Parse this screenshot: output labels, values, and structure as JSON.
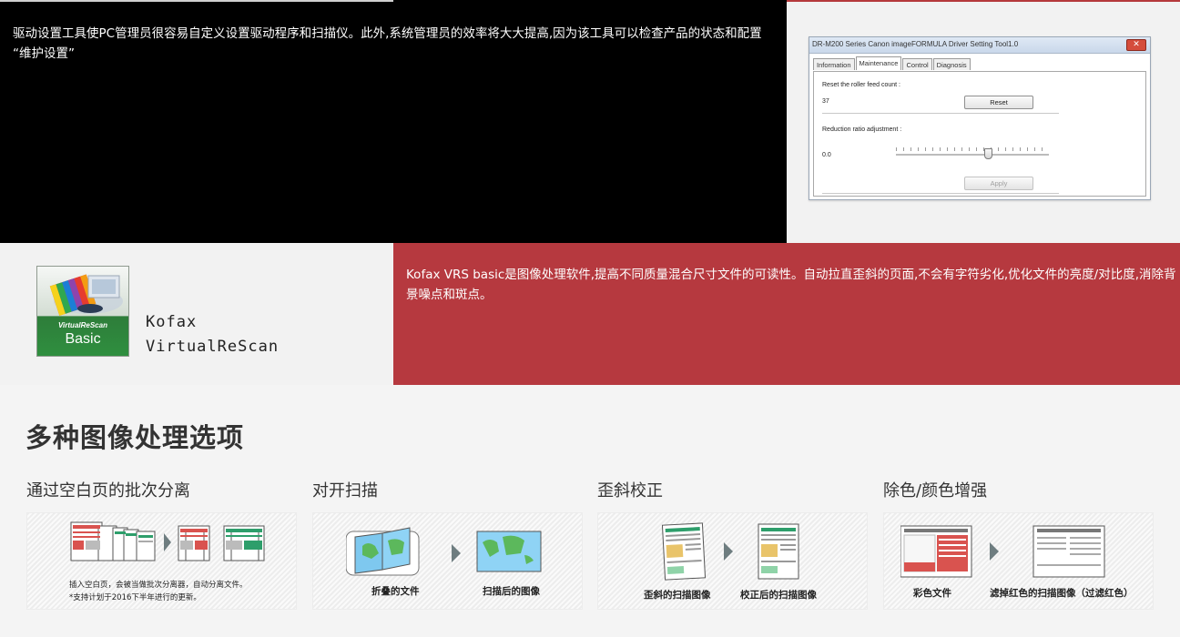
{
  "top": {
    "description": "驱动设置工具使PC管理员很容易自定义设置驱动程序和扫描仪。此外,系统管理员的效率将大大提高,因为该工具可以检查产品的状态和配置 “维护设置”"
  },
  "driver_tool": {
    "title": "DR-M200 Series Canon imageFORMULA Driver Setting Tool1.0",
    "close_label": "✕",
    "tabs": [
      "Information",
      "Maintenance",
      "Control",
      "Diagnosis"
    ],
    "active_tab": "Maintenance",
    "roller_label": "Reset the roller feed count :",
    "roller_value": "37",
    "reset_button": "Reset",
    "reduction_label": "Reduction ratio adjustment :",
    "reduction_value": "0.0",
    "slider_level": 0.6,
    "apply_button": "Apply"
  },
  "kofax": {
    "logo_small_text": "VirtualReScan",
    "logo_big_text": "Basic",
    "name_line1": "Kofax",
    "name_line2": "VirtualReScan",
    "description": "Kofax VRS basic是图像处理软件,提高不同质量混合尺寸文件的可读性。自动拉直歪斜的页面,不会有字符劣化,优化文件的亮度/对比度,消除背景噪点和斑点。"
  },
  "section_title": "多种图像处理选项",
  "features": [
    {
      "title": "通过空白页的批次分离",
      "captions": [
        "插入空白页，会被当做批次分离器，自动分离文件。",
        "*支持计划于2016下半年进行的更新。"
      ]
    },
    {
      "title": "对开扫描",
      "captions": [
        "折叠的文件",
        "扫描后的图像"
      ]
    },
    {
      "title": "歪斜校正",
      "captions": [
        "歪斜的扫描图像",
        "校正后的扫描图像"
      ]
    },
    {
      "title": "除色/颜色增强",
      "captions": [
        "彩色文件",
        "滤掉红色的扫描图像（过滤红色）"
      ]
    }
  ],
  "colors": {
    "black_panel": "#000000",
    "red_panel": "#b6393f",
    "light_panel": "#f2f2f2",
    "logo_green": "#2f8f3f",
    "doc_red": "#d9534f",
    "doc_green": "#2e9e6b"
  }
}
